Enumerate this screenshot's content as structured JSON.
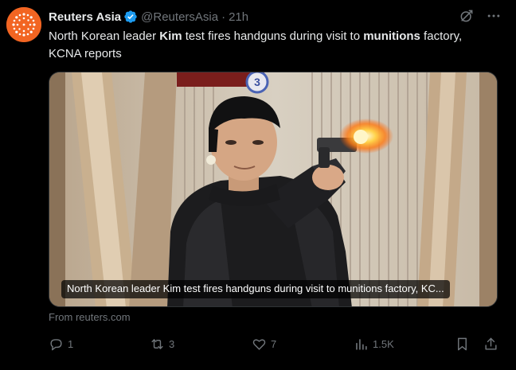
{
  "author": {
    "name": "Reuters Asia",
    "handle": "@ReutersAsia",
    "separator": "·",
    "time": "21h",
    "avatar_icon": "reuters-logo",
    "avatar_color": "#f26522",
    "verified_color": "#1d9bf0"
  },
  "tweet": {
    "text_1": "North Korean leader ",
    "bold_1": "Kim",
    "text_2": " test fires handguns during visit to ",
    "bold_2": "munitions",
    "text_3": " factory, KCNA reports"
  },
  "media": {
    "image_icon": "photo-man-firing-handgun",
    "caption": "North Korean leader Kim test fires handguns during visit to munitions factory, KC..."
  },
  "source": "From reuters.com",
  "actions": {
    "reply_count": "1",
    "retweet_count": "3",
    "like_count": "7",
    "views_count": "1.5K"
  },
  "icons": {
    "grok": "grok-icon",
    "more": "more-icon",
    "reply": "reply-icon",
    "retweet": "retweet-icon",
    "like": "heart-icon",
    "views": "views-icon",
    "bookmark": "bookmark-icon",
    "share": "share-icon"
  },
  "colors": {
    "background": "#000000",
    "text": "#e7e9ea",
    "muted": "#71767b"
  }
}
